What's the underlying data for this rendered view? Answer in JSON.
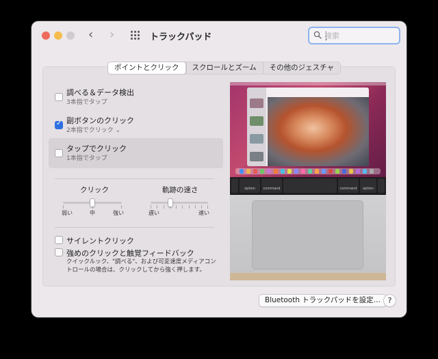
{
  "window": {
    "title": "トラックパッド"
  },
  "toolbar": {
    "back_glyph": "‹",
    "forward_glyph": "›"
  },
  "search": {
    "placeholder": "検索",
    "value": ""
  },
  "tabs": [
    {
      "label": "ポイントとクリック",
      "selected": true
    },
    {
      "label": "スクロールとズーム",
      "selected": false
    },
    {
      "label": "その他のジェスチャ",
      "selected": false
    }
  ],
  "options": [
    {
      "title": "調べる＆データ検出",
      "subtitle": "3本指でタップ",
      "checked": false
    },
    {
      "title": "副ボタンのクリック",
      "subtitle": "2本指でクリック ⌄",
      "checked": true
    },
    {
      "title": "タップでクリック",
      "subtitle": "1本指でタップ",
      "checked": false
    }
  ],
  "sliders": {
    "click": {
      "label": "クリック",
      "min_label": "弱い",
      "mid_label": "中",
      "max_label": "強い",
      "value_fraction": 0.5
    },
    "tracking": {
      "label": "軌跡の速さ",
      "min_label": "遅い",
      "max_label": "速い",
      "value_fraction": 0.35
    }
  },
  "lower_options": [
    {
      "title": "サイレントクリック",
      "checked": false
    },
    {
      "title": "強めのクリックと触覚フィードバック",
      "checked": false
    }
  ],
  "description": "クイックルック、\"調べる\"、および可変速度メディアコントロールの場合は、クリックしてから強く押します。",
  "preview": {
    "keys": {
      "left_option": "option",
      "left_command": "command",
      "right_command": "command",
      "right_option": "option"
    }
  },
  "buttons": {
    "bluetooth": "Bluetooth トラックパッドを設定...",
    "help": "?"
  },
  "colors": {
    "accent": "#2f6fe0",
    "search_focus": "#8eb3ec"
  }
}
